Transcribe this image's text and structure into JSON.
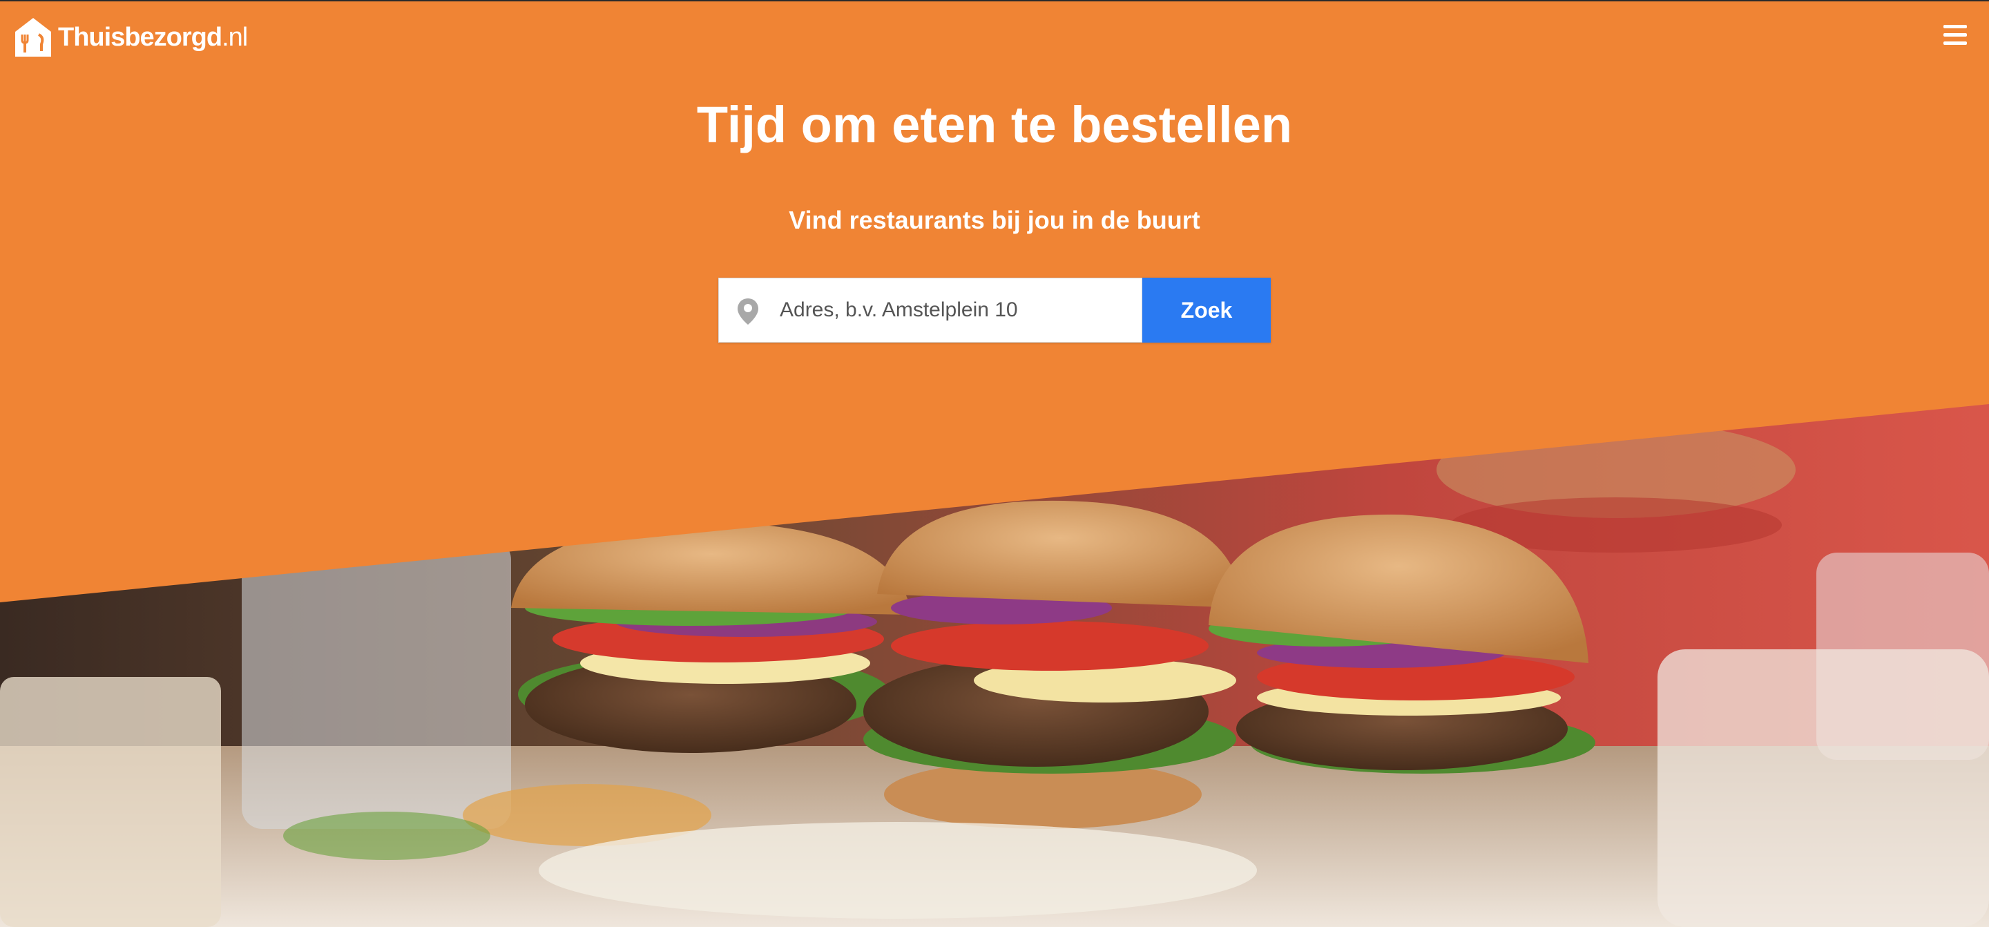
{
  "brand": {
    "name": "Thuisbezorgd",
    "tld": ".nl"
  },
  "header": {
    "menu_icon": "hamburger-menu-icon"
  },
  "hero": {
    "title": "Tijd om eten te bestellen",
    "subtitle": "Vind restaurants bij jou in de buurt",
    "image_subject": "burgers-photo"
  },
  "search": {
    "placeholder": "Adres, b.v. Amstelplein 10",
    "value": "",
    "location_icon": "location-pin-icon",
    "button_label": "Zoek"
  },
  "colors": {
    "brand_orange": "#f08434",
    "search_blue": "#2a7af2",
    "text_white": "#ffffff"
  }
}
